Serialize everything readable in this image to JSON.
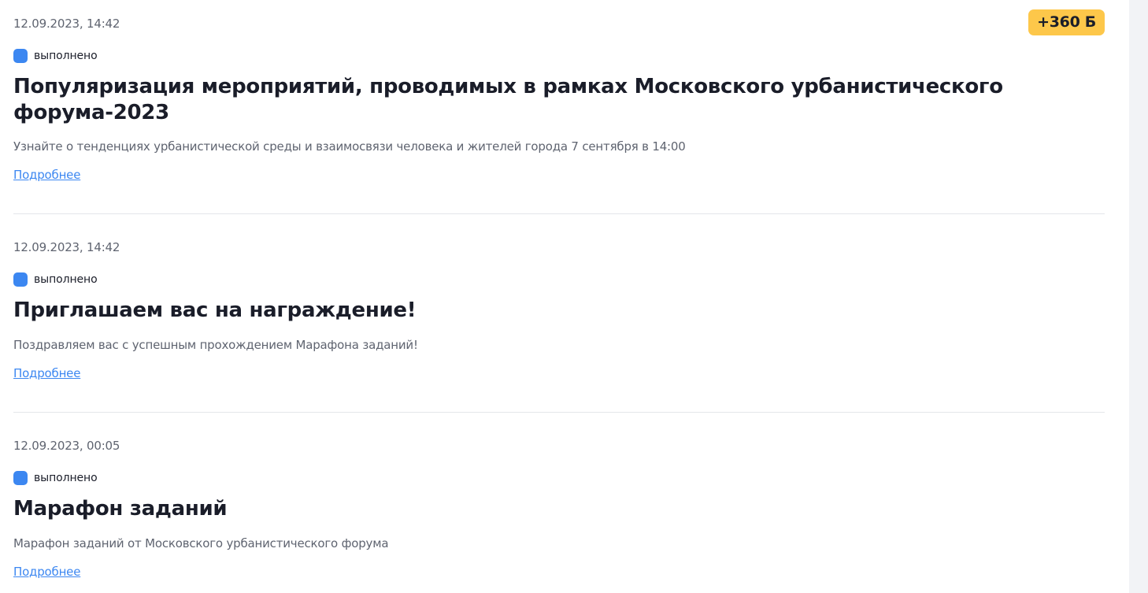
{
  "feed": {
    "items": [
      {
        "date": "12.09.2023, 14:42",
        "status": "выполнено",
        "title": "Популяризация мероприятий, проводимых в рамках Московского урбанистического форума-2023",
        "description": "Узнайте о тенденциях урбанистической среды и взаимосвязи человека и жителей города 7 сентября в 14:00",
        "more_label": "Подробнее",
        "points": "+360 Б"
      },
      {
        "date": "12.09.2023, 14:42",
        "status": "выполнено",
        "title": "Приглашаем вас на награждение!",
        "description": "Поздравляем вас с успешным прохождением Марафона заданий!",
        "more_label": "Подробнее"
      },
      {
        "date": "12.09.2023, 00:05",
        "status": "выполнено",
        "title": "Марафон заданий",
        "description": "Марафон заданий от Московского урбанистического форума",
        "more_label": "Подробнее"
      }
    ]
  },
  "colors": {
    "status_done": "#3c87f1",
    "points_badge": "#fdc74a",
    "link": "#3c87f1",
    "divider": "#e4e6ea"
  }
}
